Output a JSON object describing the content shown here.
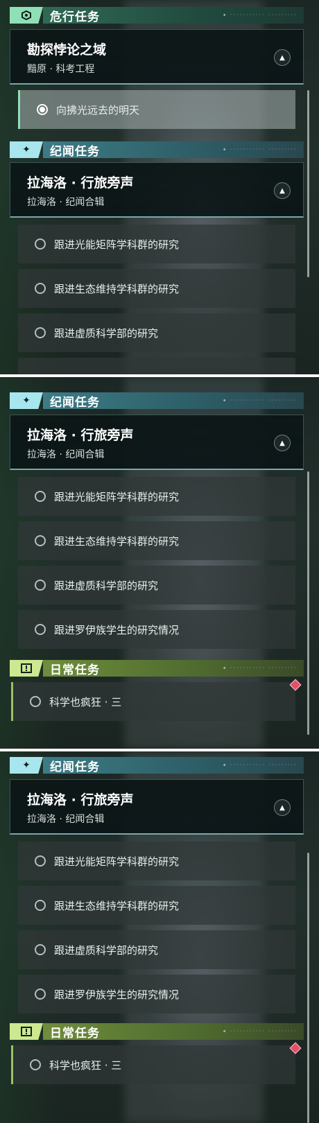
{
  "section1": {
    "danger_header": "危行任务",
    "danger_card": {
      "title": "勘探悖论之域",
      "subtitle": "黯原 · 科考工程"
    },
    "danger_task": "向拂光远去的明天",
    "lore_header": "纪闻任务",
    "lore_card": {
      "title": "拉海洛 · 行旅旁声",
      "subtitle": "拉海洛 · 纪闻合辑"
    },
    "tasks": [
      "跟进光能矩阵学科群的研究",
      "跟进生态维持学科群的研究",
      "跟进虚质科学部的研究"
    ]
  },
  "section2": {
    "lore_header": "纪闻任务",
    "lore_card": {
      "title": "拉海洛 · 行旅旁声",
      "subtitle": "拉海洛 · 纪闻合辑"
    },
    "tasks": [
      "跟进光能矩阵学科群的研究",
      "跟进生态维持学科群的研究",
      "跟进虚质科学部的研究",
      "跟进罗伊族学生的研究情况"
    ],
    "daily_header": "日常任务",
    "daily_task": "科学也疯狂 · 三"
  },
  "section3": {
    "lore_header": "纪闻任务",
    "lore_card": {
      "title": "拉海洛 · 行旅旁声",
      "subtitle": "拉海洛 · 纪闻合辑"
    },
    "tasks": [
      "跟进光能矩阵学科群的研究",
      "跟进生态维持学科群的研究",
      "跟进虚质科学部的研究",
      "跟进罗伊族学生的研究情况"
    ],
    "daily_header": "日常任务",
    "daily_task": "科学也疯狂 · 三"
  },
  "icons": {
    "danger": "danger-quest-icon",
    "lore": "sparkle-icon",
    "daily": "exclamation-icon",
    "collapse": "chevron-up-icon"
  },
  "colors": {
    "danger_accent": "#8fe0b6",
    "lore_accent": "#a7e6ee",
    "daily_accent": "#cde890",
    "tracked_marker": "#e05068"
  }
}
